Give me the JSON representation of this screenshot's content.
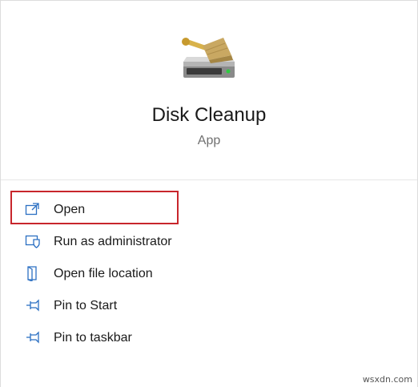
{
  "app": {
    "name": "Disk Cleanup",
    "type": "App",
    "icon": "disk-cleanup-icon"
  },
  "menu": {
    "items": [
      {
        "label": "Open",
        "icon": "open-window-icon",
        "highlighted": true
      },
      {
        "label": "Run as administrator",
        "icon": "shield-icon"
      },
      {
        "label": "Open file location",
        "icon": "file-location-icon"
      },
      {
        "label": "Pin to Start",
        "icon": "pin-icon"
      },
      {
        "label": "Pin to taskbar",
        "icon": "pin-icon"
      }
    ]
  },
  "colors": {
    "icon_blue": "#2b6fc2",
    "highlight_red": "#c8262c",
    "text": "#1a1a1a",
    "subtext": "#707070"
  },
  "watermark": "wsxdn.com"
}
